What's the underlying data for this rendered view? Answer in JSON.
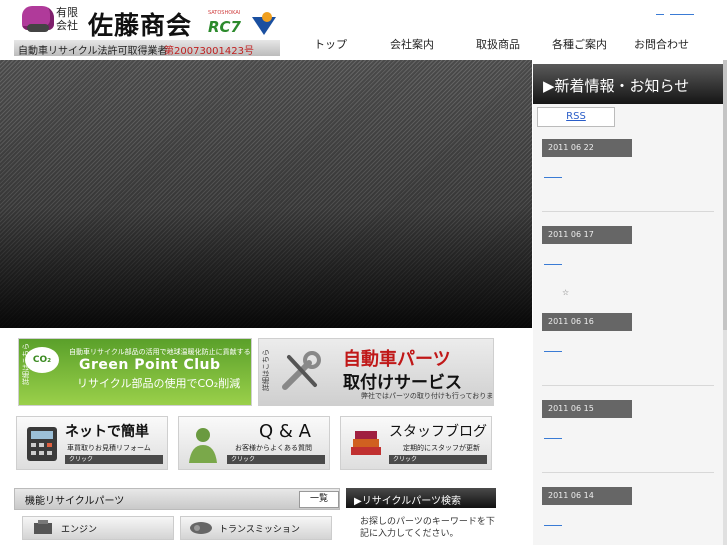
{
  "header": {
    "company_prefix": "有限会社",
    "company_name": "佐藤商会",
    "rc7": "RC7",
    "rc7_small": "SATOSHOKAI",
    "tagline": "自動車リサイクル法許可取得業者",
    "permit_no": "第20073001423号"
  },
  "nav": {
    "items": [
      "トップ",
      "会社案内",
      "取扱商品",
      "各種ご案内",
      "お問合わせ"
    ]
  },
  "news": {
    "heading": "▶新着情報・お知らせ",
    "rss_label": "RSS",
    "dates": [
      "2011 06 22",
      "2011 06 17",
      "2011 06 16",
      "2011 06 15",
      "2011 06 14"
    ],
    "star": "☆"
  },
  "banners": {
    "green_point": {
      "icon": "CO₂",
      "desc": "自動車リサイクル部品の活用で地球温暖化防止に貢献する",
      "title": "Green Point Club",
      "sub": "リサイクル部品の使用でCO₂削減",
      "more": "詳細はこちら"
    },
    "parts_install": {
      "title": "自動車パーツ",
      "title2": "取付けサービス",
      "sub": "弊社ではパーツの取り付けも行っております。",
      "more": "詳細はこちら"
    },
    "net_simple": {
      "title": "ネットで簡単",
      "sub": "車買取りお見積リフォーム",
      "click": "クリック"
    },
    "qa": {
      "title": "Q & A",
      "sub": "お客様からよくある質問",
      "click": "クリック"
    },
    "staff_blog": {
      "title": "スタッフブログ",
      "sub": "定期的にスタッフが更新",
      "click": "クリック"
    }
  },
  "parts_section": {
    "title": "機能リサイクルパーツ",
    "all_label": "一覧",
    "categories": [
      "エンジン",
      "トランスミッション"
    ]
  },
  "search": {
    "heading": "▶リサイクルパーツ検索",
    "text": "お探しのパーツのキーワードを下記に入力してください。"
  },
  "colors": {
    "accent_red": "#c01818",
    "green": "#5aa02a",
    "link": "#3a7bd5"
  }
}
